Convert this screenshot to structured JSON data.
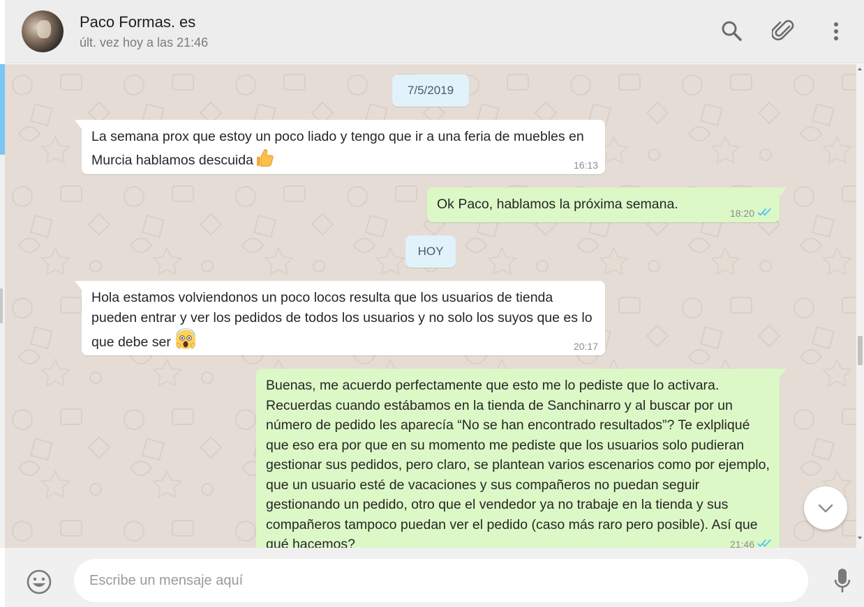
{
  "header": {
    "contact_name": "Paco Formas. es",
    "last_seen": "últ. vez hoy a las 21:46",
    "icons": [
      "search-icon",
      "attach-icon",
      "more-options-icon"
    ]
  },
  "chat": {
    "date_chip_1": "7/5/2019",
    "date_chip_2": "HOY",
    "messages": [
      {
        "direction": "in",
        "text": "La semana prox que estoy un poco liado y tengo que ir a una feria de muebles en Murcia hablamos descuida",
        "emoji": "thumbs-up",
        "time": "16:13"
      },
      {
        "direction": "out",
        "text": "Ok Paco, hablamos la próxima semana.",
        "time": "18:20",
        "status": "read"
      },
      {
        "direction": "in",
        "text": "Hola estamos volviendonos un poco locos resulta que los usuarios de tienda pueden entrar y ver los pedidos de todos los usuarios y no solo los suyos que es lo que debe ser",
        "emoji": "screaming-face",
        "time": "20:17"
      },
      {
        "direction": "out",
        "text": "Buenas, me acuerdo perfectamente que esto me lo pediste que lo activara. Recuerdas cuando estábamos en la tienda de Sanchinarro y al buscar por un número de pedido les aparecía “No se han encontrado resultados”? Te exlpliqué que eso era por que en su momento me pediste que los usuarios solo pudieran gestionar sus pedidos, pero claro, se plantean varios escenarios como por ejemplo, que un usuario esté de vacaciones y sus compañeros no puedan seguir gestionando un pedido, otro que el vendedor ya no trabaje en la tienda y sus compañeros tampoco puedan ver el pedido (caso más raro pero posible). Así que qué hacemos?",
        "time": "21:46",
        "status": "read"
      }
    ]
  },
  "composer": {
    "placeholder": "Escribe un mensaje aquí"
  },
  "colors": {
    "incoming_bubble": "#ffffff",
    "outgoing_bubble": "#dcf8c6",
    "chat_background": "#e5ddd5",
    "read_ticks": "#4fc3f7",
    "date_chip": "#e1f2fb"
  }
}
